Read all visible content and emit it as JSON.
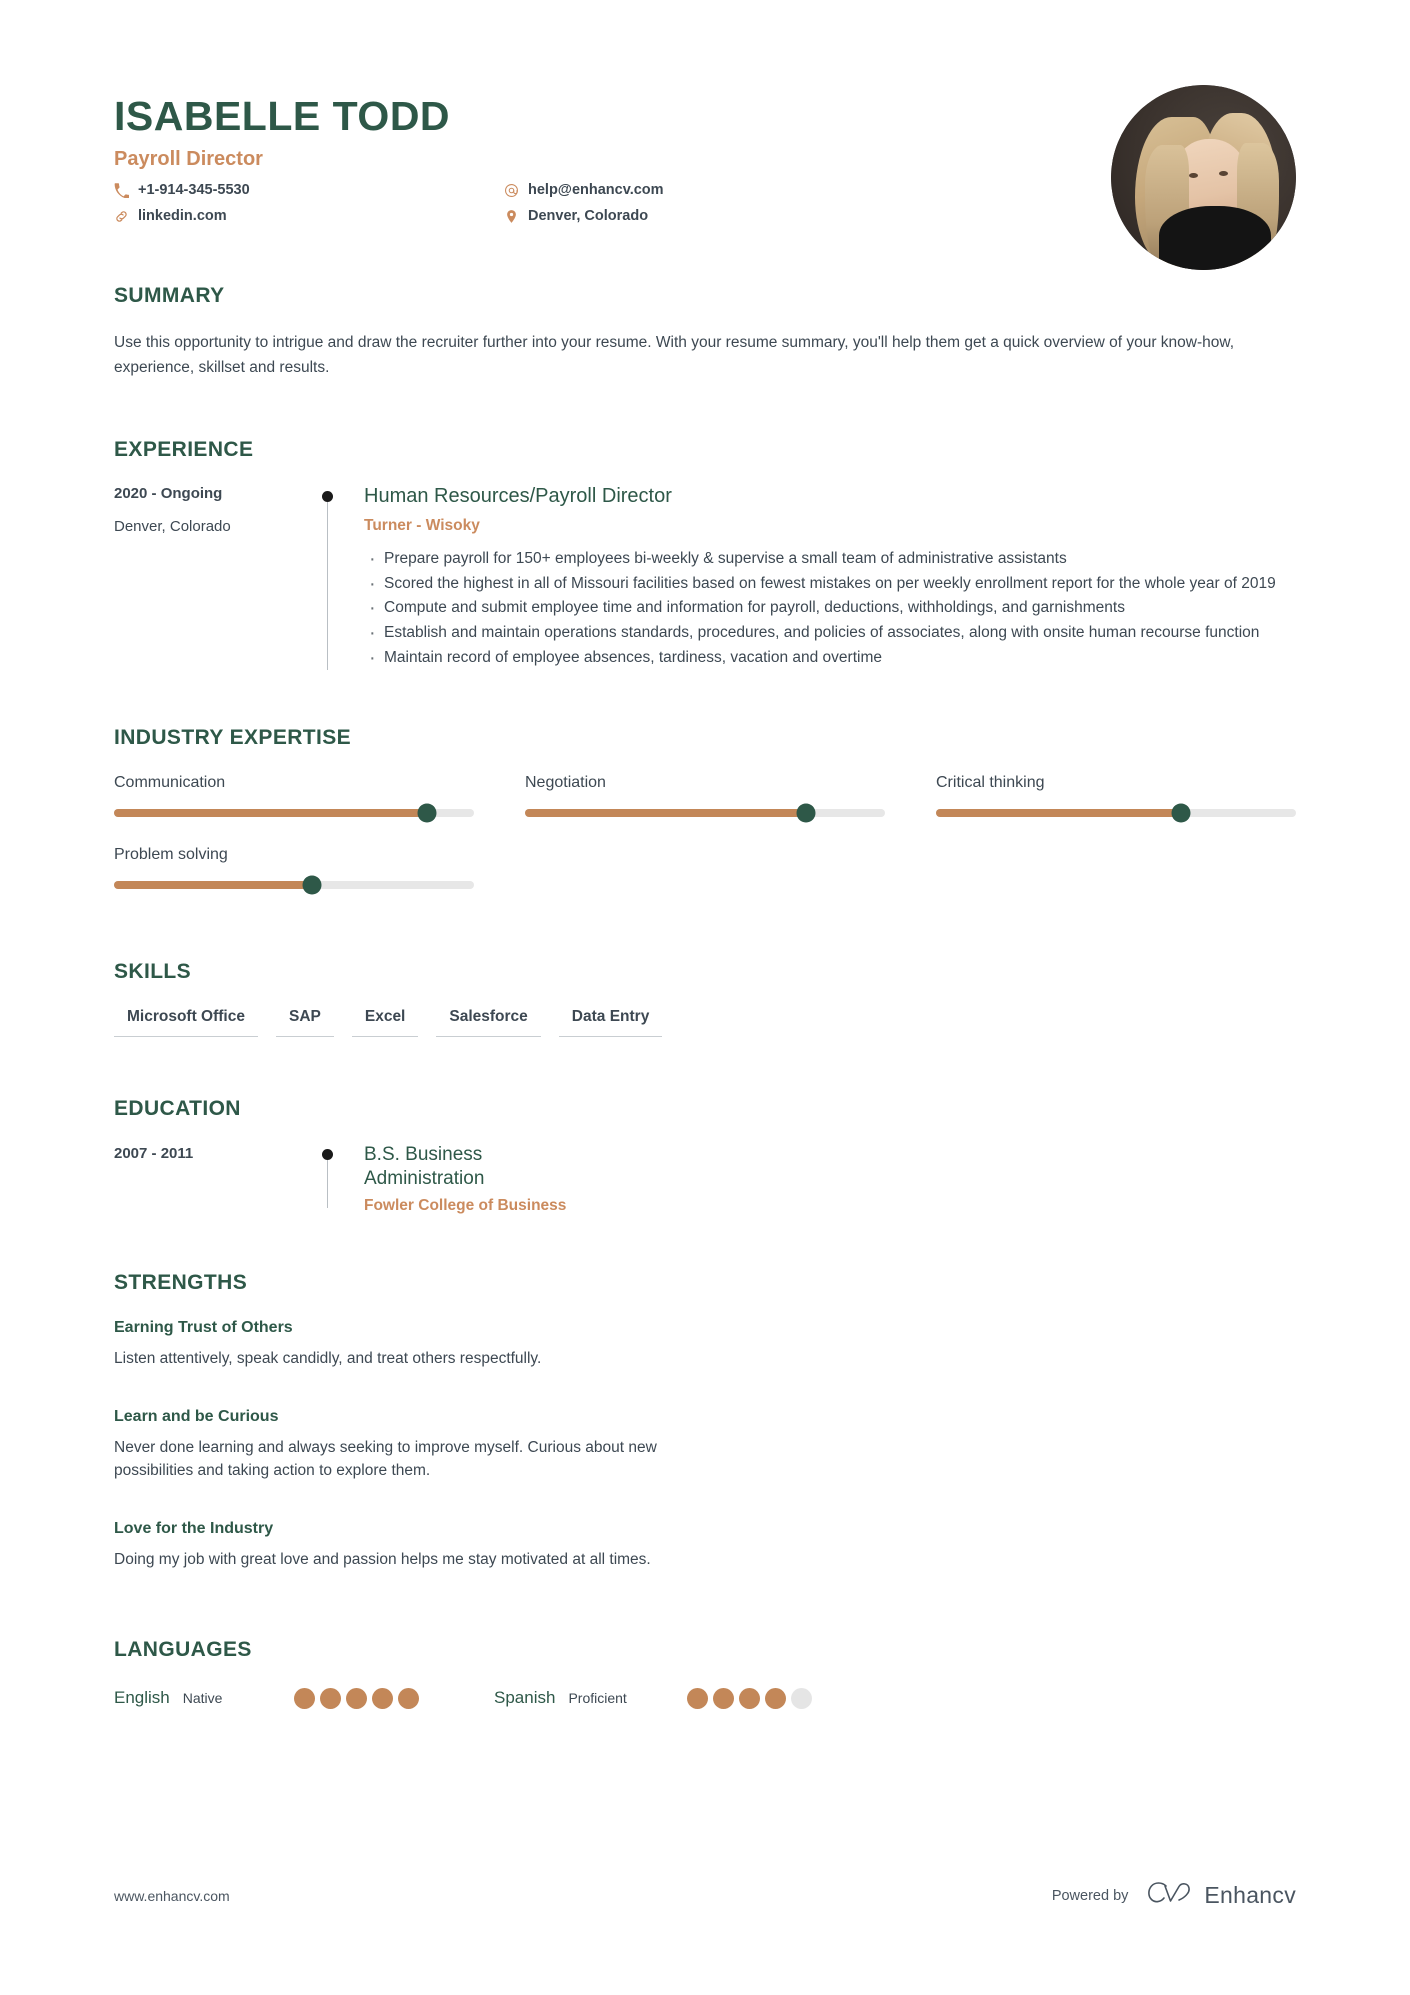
{
  "header": {
    "name": "ISABELLE TODD",
    "job_title": "Payroll Director",
    "contacts": [
      {
        "icon": "phone-icon",
        "value": "+1-914-345-5530"
      },
      {
        "icon": "link-icon",
        "value": "linkedin.com"
      },
      {
        "icon": "email-icon",
        "value": "help@enhancv.com"
      },
      {
        "icon": "location-pin-icon",
        "value": "Denver, Colorado"
      }
    ]
  },
  "summary": {
    "title": "SUMMARY",
    "text": "Use this opportunity to intrigue and draw the recruiter further into your resume. With your resume summary, you'll help them get a quick overview of your know-how, experience, skillset and results."
  },
  "experience": {
    "title": "EXPERIENCE",
    "entries": [
      {
        "date": "2020 - Ongoing",
        "location": "Denver, Colorado",
        "role": "Human Resources/Payroll Director",
        "company": "Turner - Wisoky",
        "bullets": [
          "Prepare payroll for 150+ employees bi-weekly & supervise a small team of administrative assistants",
          "Scored the highest in all of Missouri facilities based on fewest mistakes on per weekly enrollment report for the whole year of 2019",
          "Compute and submit employee time and information for payroll, deductions, withholdings, and garnishments",
          "Establish and maintain operations standards, procedures, and policies of associates, along with onsite human recourse function",
          "Maintain record of employee absences, tardiness, vacation and overtime"
        ]
      }
    ]
  },
  "industry_expertise": {
    "title": "INDUSTRY EXPERTISE",
    "items": [
      {
        "label": "Communication",
        "value": 87
      },
      {
        "label": "Negotiation",
        "value": 78
      },
      {
        "label": "Critical thinking",
        "value": 68
      },
      {
        "label": "Problem solving",
        "value": 55
      }
    ]
  },
  "skills": {
    "title": "SKILLS",
    "items": [
      "Microsoft Office",
      "SAP",
      "Excel",
      "Salesforce",
      "Data Entry"
    ]
  },
  "education": {
    "title": "EDUCATION",
    "entries": [
      {
        "date": "2007 - 2011",
        "degree": "B.S. Business Administration",
        "school": "Fowler College of Business"
      }
    ]
  },
  "strengths": {
    "title": "STRENGTHS",
    "items": [
      {
        "title": "Earning Trust of Others",
        "desc": "Listen attentively, speak candidly, and treat others respectfully."
      },
      {
        "title": "Learn and be Curious",
        "desc": "Never done learning and always seeking to improve myself. Curious about new possibilities and taking action to explore them."
      },
      {
        "title": "Love for the Industry",
        "desc": "Doing my job with great love and passion helps me stay motivated at all times."
      }
    ]
  },
  "languages": {
    "title": "LANGUAGES",
    "items": [
      {
        "name": "English",
        "level": "Native",
        "rating": 5,
        "max": 5
      },
      {
        "name": "Spanish",
        "level": "Proficient",
        "rating": 4,
        "max": 5
      }
    ]
  },
  "footer": {
    "url": "www.enhancv.com",
    "powered_by": "Powered by",
    "brand": "Enhancv"
  },
  "colors": {
    "primary_green": "#2e5848",
    "accent_orange": "#cb8b5e",
    "slider_fill": "#c38758",
    "track_gray": "#e7e7e7",
    "body_text": "#3d4852"
  }
}
